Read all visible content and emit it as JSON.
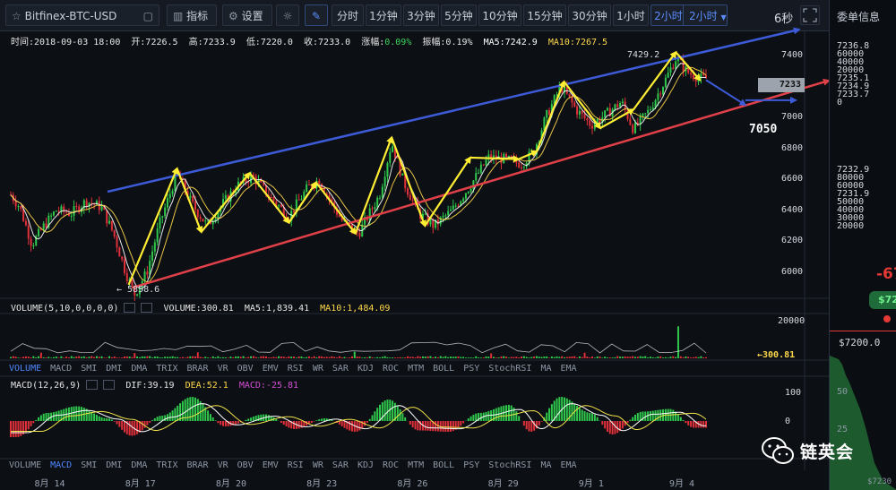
{
  "toolbar": {
    "symbol": "Bitfinex-BTC-USD",
    "indicators_label": "指标",
    "settings_label": "设置",
    "intervals": [
      "分时",
      "1分钟",
      "3分钟",
      "5分钟",
      "10分钟",
      "15分钟",
      "30分钟",
      "1小时",
      "2小时"
    ],
    "active_interval": "2小时",
    "dropdown_label": "2小时",
    "refresh": "6秒"
  },
  "info": {
    "time": "时间:2018-09-03 18:00",
    "open": "开:7226.5",
    "high": "高:7233.9",
    "low": "低:7220.0",
    "close": "收:7233.0",
    "change": "涨幅:0.09%",
    "amplitude": "振幅:0.19%",
    "ma5": "MA5:7242.9",
    "ma10": "MA10:7267.5"
  },
  "volume_info": {
    "title": "VOLUME(5,10,0,0,0,0)",
    "volume": "VOLUME:300.81",
    "ma5": "MA5:1,839.41",
    "ma10": "MA10:1,484.09",
    "current": "←300.81"
  },
  "macd_info": {
    "title": "MACD(12,26,9)",
    "dif": "DIF:39.19",
    "dea": "DEA:52.1",
    "macd": "MACD:-25.81"
  },
  "indicator_tabs": [
    "VOLUME",
    "MACD",
    "SMI",
    "DMI",
    "DMA",
    "TRIX",
    "BRAR",
    "VR",
    "OBV",
    "EMV",
    "RSI",
    "WR",
    "SAR",
    "KDJ",
    "ROC",
    "MTM",
    "BOLL",
    "PSY",
    "StochRSI",
    "MA",
    "EMA"
  ],
  "price_axis": [
    "7400",
    "7200",
    "7000",
    "6800",
    "6600",
    "6400",
    "6200",
    "6000"
  ],
  "volume_axis": [
    "20000"
  ],
  "macd_axis": [
    "100",
    "0"
  ],
  "date_axis": [
    "8月 14",
    "8月 17",
    "8月 20",
    "8月 23",
    "8月 26",
    "8月 29",
    "9月 1",
    "9月 4"
  ],
  "current_price": "7233",
  "annotations": {
    "high": "7429.2",
    "low": "← 5858.6",
    "target": "7050"
  },
  "orderbook": {
    "title": "委单信息",
    "asks": [
      "7236.8",
      "60000",
      "40000",
      "20000",
      "7235.1",
      "7234.9",
      "7233.7",
      "0"
    ],
    "bids": [
      "7232.9",
      "80000",
      "60000",
      "7231.9",
      "50000",
      "40000",
      "30000",
      "20000"
    ],
    "last_change": "-67",
    "last_pill": "$72",
    "mark_price": "$7200.0",
    "depth_axis": [
      "50",
      "25"
    ],
    "bottom_price": "$7230"
  },
  "watermark": "链英会",
  "colors": {
    "up": "#2fc84c",
    "down": "#e0303a",
    "ma5": "#ffffff",
    "ma10": "#ffd84a",
    "upper_trend": "#3d5bd8",
    "lower_trend": "#e04048",
    "zigzag": "#ffee33"
  },
  "chart_data": {
    "type": "candlestick",
    "x_range": [
      "2018-08-13",
      "2018-09-04"
    ],
    "ylim": [
      5850,
      7450
    ],
    "price_path": [
      [
        0,
        6500
      ],
      [
        0.3,
        6420
      ],
      [
        0.7,
        6180
      ],
      [
        1.1,
        6300
      ],
      [
        1.5,
        6400
      ],
      [
        2.0,
        6380
      ],
      [
        2.5,
        6460
      ],
      [
        3.0,
        6420
      ],
      [
        3.4,
        6250
      ],
      [
        3.8,
        6000
      ],
      [
        4.1,
        5860
      ],
      [
        4.5,
        6000
      ],
      [
        4.9,
        6300
      ],
      [
        5.5,
        6640
      ],
      [
        6.0,
        6440
      ],
      [
        6.5,
        6300
      ],
      [
        7.0,
        6440
      ],
      [
        7.5,
        6560
      ],
      [
        8.0,
        6620
      ],
      [
        8.6,
        6480
      ],
      [
        9.2,
        6360
      ],
      [
        9.8,
        6540
      ],
      [
        10.2,
        6600
      ],
      [
        10.6,
        6450
      ],
      [
        11.0,
        6320
      ],
      [
        11.5,
        6250
      ],
      [
        12.2,
        6500
      ],
      [
        12.6,
        6840
      ],
      [
        13.0,
        6580
      ],
      [
        13.5,
        6380
      ],
      [
        14.0,
        6300
      ],
      [
        14.6,
        6400
      ],
      [
        15.2,
        6560
      ],
      [
        15.8,
        6740
      ],
      [
        16.3,
        6730
      ],
      [
        16.9,
        6700
      ],
      [
        17.3,
        6780
      ],
      [
        17.7,
        7000
      ],
      [
        18.2,
        7200
      ],
      [
        18.7,
        7050
      ],
      [
        19.2,
        6950
      ],
      [
        19.7,
        7020
      ],
      [
        20.2,
        7100
      ],
      [
        20.6,
        6920
      ],
      [
        21.1,
        7040
      ],
      [
        21.6,
        7220
      ],
      [
        22.0,
        7380
      ],
      [
        22.4,
        7290
      ],
      [
        22.8,
        7250
      ]
    ],
    "volume_spikes": [
      [
        1.0,
        3000
      ],
      [
        4.1,
        2800
      ],
      [
        6.2,
        3200
      ],
      [
        11.4,
        3500
      ],
      [
        15.9,
        2600
      ],
      [
        19.0,
        3000
      ],
      [
        22.1,
        17000
      ]
    ],
    "macd_hist_envelope": [
      [
        0.2,
        -60
      ],
      [
        1.2,
        30
      ],
      [
        2.2,
        55
      ],
      [
        3.2,
        10
      ],
      [
        4.0,
        -55
      ],
      [
        5.0,
        20
      ],
      [
        6.0,
        90
      ],
      [
        7.1,
        -20
      ],
      [
        8.4,
        25
      ],
      [
        9.4,
        -30
      ],
      [
        10.4,
        10
      ],
      [
        11.4,
        -40
      ],
      [
        12.5,
        80
      ],
      [
        13.5,
        -35
      ],
      [
        14.5,
        -40
      ],
      [
        15.5,
        30
      ],
      [
        16.5,
        60
      ],
      [
        17.2,
        -40
      ],
      [
        18.2,
        90
      ],
      [
        19.2,
        30
      ],
      [
        19.9,
        -50
      ],
      [
        20.9,
        35
      ],
      [
        21.8,
        45
      ],
      [
        22.6,
        -25
      ]
    ],
    "trend_lines": {
      "upper": {
        "from": [
          3.2,
          6520
        ],
        "to": [
          24.3,
          7550
        ]
      },
      "lower": {
        "from": [
          4.0,
          5900
        ],
        "to": [
          24.3,
          7250
        ]
      },
      "projection": {
        "from": [
          23.0,
          7240
        ],
        "to": [
          24.0,
          7080
        ],
        "level": 7050
      }
    }
  }
}
